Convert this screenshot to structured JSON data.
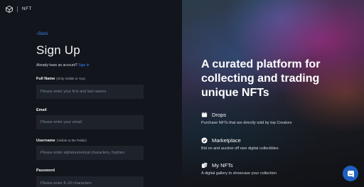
{
  "brand": {
    "logo_text": "NFT",
    "logo_icon": "diamond-cube-icon"
  },
  "signup": {
    "back_label": "Back",
    "title": "Sign Up",
    "already_text": "Already have an account?",
    "signin_link": "Sign in",
    "fields": [
      {
        "label": "Full Name",
        "hint": "(Only Visible to You)",
        "placeholder": "Please enter your first and last names",
        "value": ""
      },
      {
        "label": "Email",
        "hint": "",
        "placeholder": "Please enter your email",
        "value": ""
      },
      {
        "label": "Username",
        "hint": "(Visible to the Public)",
        "placeholder": "Please enter alphanumerical characters, hyphen",
        "value": ""
      },
      {
        "label": "Password",
        "hint": "",
        "placeholder": "Please enter 8–20 characters",
        "value": ""
      }
    ]
  },
  "hero": {
    "headline": "A curated platform for collecting and trading unique NFTs",
    "features": [
      {
        "icon": "drops-icon",
        "title": "Drops",
        "description": "Purchase NFTs that are directly sold by top Creators"
      },
      {
        "icon": "marketplace-icon",
        "title": "Marketplace",
        "description": "Bid on and auction off rare digital collectibles"
      },
      {
        "icon": "my-nfts-icon",
        "title": "My NFTs",
        "description": "A digital gallery to showcase your collection"
      }
    ]
  },
  "chat": {
    "icon": "chat-icon"
  },
  "colors": {
    "accent": "#3b82f6",
    "panel": "#12151b",
    "input_bg": "#1e232b",
    "chat": "#1f5fbf"
  }
}
